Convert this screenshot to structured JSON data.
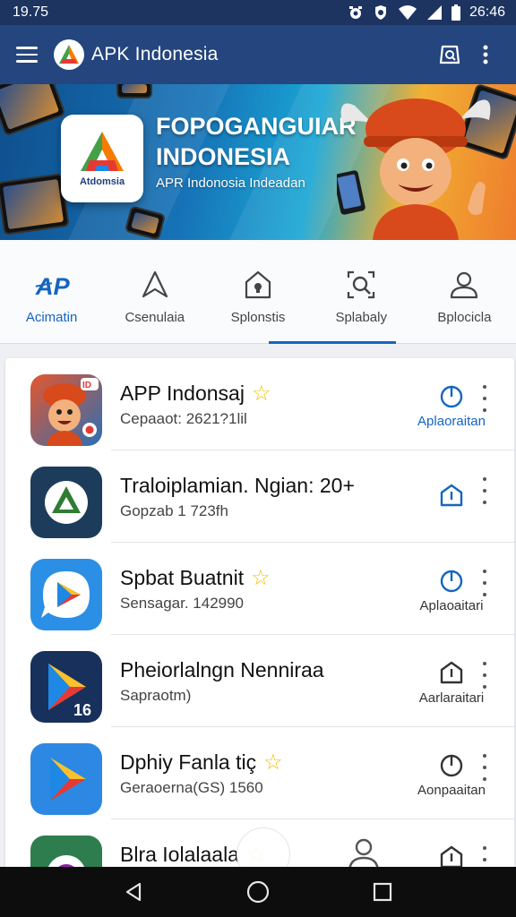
{
  "status_bar": {
    "time": "19.75",
    "clock": "26:46"
  },
  "app_bar": {
    "title": "APK Indonesia",
    "icons": [
      "menu-icon",
      "app-logo",
      "search-icon",
      "more-vert-icon"
    ]
  },
  "banner": {
    "title_line1": "FOPOGANGUIAR",
    "title_line2": "INDONESIA",
    "subtitle": "APR Indonosia Indeadan",
    "logo_text": "Atdomsia"
  },
  "tabs": [
    {
      "label": "Acimatin",
      "icon": "ap-logo-icon",
      "active": true
    },
    {
      "label": "Csenulaia",
      "icon": "navigation-icon",
      "active": false
    },
    {
      "label": "Splonstis",
      "icon": "lock-home-icon",
      "active": false
    },
    {
      "label": "Splabaly",
      "icon": "search-frame-icon",
      "active": false
    },
    {
      "label": "Bplocicla",
      "icon": "user-icon",
      "active": false
    }
  ],
  "apps": [
    {
      "name": "APP Indonsaj",
      "meta": "Cepaaot: 2621?1lil",
      "star": true,
      "action_label": "Aplaoraitan",
      "action_icon": "power-icon",
      "icon": "mascot-icon"
    },
    {
      "name": "Traloiplamian. Ngian: 20+",
      "meta": "Gopzab 1 723fh",
      "star": false,
      "action_label": "",
      "action_icon": "info-house-icon",
      "icon": "triangle-logo-icon"
    },
    {
      "name": "Spbat Buatnit",
      "meta": "Sensagar. 142990",
      "star": true,
      "action_label": "Aplaoaitari",
      "action_icon": "power-icon",
      "icon": "play-chat-icon"
    },
    {
      "name": "Pheiorlalngn Nenniraa",
      "meta": "Sapraotm)",
      "star": false,
      "action_label": "Aarlaraitari",
      "action_icon": "info-house-icon",
      "icon": "play-16-icon"
    },
    {
      "name": "Dphiy Fanla tiç",
      "meta": "Geraoerna(GS) 1560",
      "star": true,
      "action_label": "Aonpaaitan",
      "action_icon": "power-icon",
      "icon": "play-blue-icon"
    },
    {
      "name": "Blra Iolalaala",
      "meta": "",
      "star": true,
      "action_label": "",
      "action_icon": "info-house-icon",
      "icon": "purple-app-icon"
    }
  ],
  "colors": {
    "app_bar": "#24457d",
    "accent": "#1565c0",
    "star": "#f2c200"
  }
}
